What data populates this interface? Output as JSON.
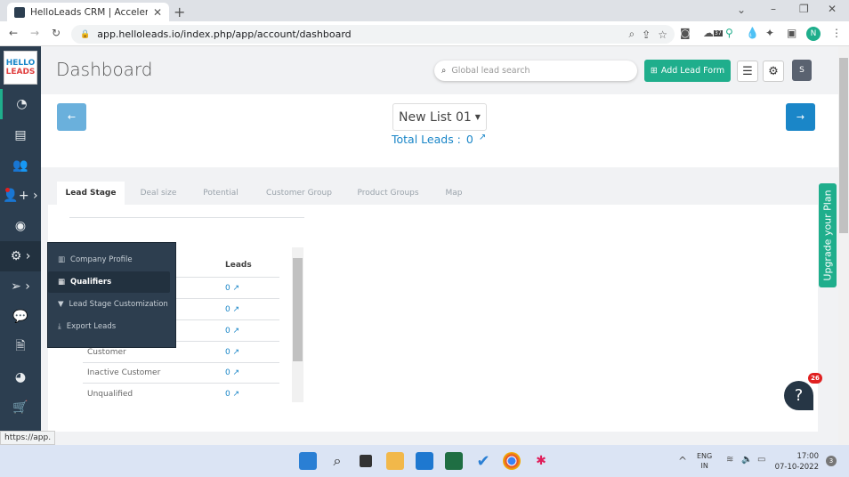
{
  "browser": {
    "tab_title": "HelloLeads CRM | Accelerate You",
    "url": "app.helloleads.io/index.php/app/account/dashboard",
    "profile_initial": "N",
    "extension_badge": "37",
    "status_url": "https://app."
  },
  "app": {
    "logo_top": "HELLO",
    "logo_bottom": "LEADS",
    "page_title": "Dashboard",
    "search_placeholder": "Global lead search",
    "add_lead_form": "Add Lead Form",
    "user_initial": "S",
    "accent": "#1fae8c",
    "primary": "#1a86c8"
  },
  "list": {
    "selected": "New List 01",
    "total_label": "Total Leads :",
    "total_value": "0"
  },
  "tabs": [
    "Lead Stage",
    "Deal size",
    "Potential",
    "Customer Group",
    "Product Groups",
    "Map"
  ],
  "table": {
    "header": "Leads",
    "rows": [
      {
        "stage": "",
        "leads": "0"
      },
      {
        "stage": "",
        "leads": "0"
      },
      {
        "stage": "",
        "leads": "0"
      },
      {
        "stage": "Customer",
        "leads": "0"
      },
      {
        "stage": "Inactive Customer",
        "leads": "0"
      },
      {
        "stage": "Unqualified",
        "leads": "0"
      }
    ]
  },
  "settings_menu": [
    "Company Profile",
    "Qualifiers",
    "Lead Stage Customization",
    "Export Leads"
  ],
  "upgrade": "Upgrade your Plan",
  "help": {
    "label": "?",
    "badge": "26"
  },
  "taskbar": {
    "lang1": "ENG",
    "lang2": "IN",
    "time": "17:00",
    "date": "07-10-2022",
    "notif": "3"
  }
}
